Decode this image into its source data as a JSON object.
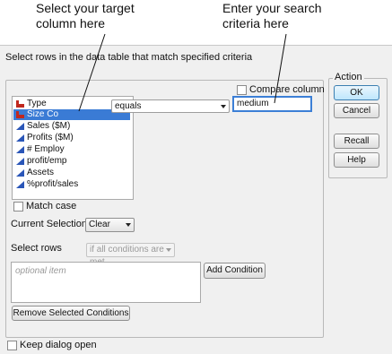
{
  "callouts": {
    "target_column": [
      "Select your target",
      "column here"
    ],
    "search_criteria": [
      "Enter your search",
      "criteria here"
    ]
  },
  "dialog": {
    "instruction": "Select rows in the data table that match specified criteria",
    "action_group": {
      "title": "Action",
      "ok": "OK",
      "cancel": "Cancel",
      "recall": "Recall",
      "help": "Help"
    },
    "columns": [
      {
        "label": "Type",
        "icon": "nominal-bar-icon",
        "icon_color": "#c0281e"
      },
      {
        "label": "Size Co",
        "icon": "nominal-bar-icon",
        "icon_color": "#c0281e",
        "selected": true
      },
      {
        "label": "Sales ($M)",
        "icon": "continuous-triangle-icon",
        "icon_color": "#2a56b8"
      },
      {
        "label": "Profits ($M)",
        "icon": "continuous-triangle-icon",
        "icon_color": "#2a56b8"
      },
      {
        "label": "# Employ",
        "icon": "continuous-triangle-icon",
        "icon_color": "#2a56b8"
      },
      {
        "label": "profit/emp",
        "icon": "continuous-triangle-icon",
        "icon_color": "#2a56b8"
      },
      {
        "label": "Assets",
        "icon": "continuous-triangle-icon",
        "icon_color": "#2a56b8"
      },
      {
        "label": "%profit/sales",
        "icon": "continuous-triangle-icon",
        "icon_color": "#2a56b8"
      }
    ],
    "operator": "equals",
    "compare_column": "Compare column",
    "search_value": "medium",
    "match_case": "Match case",
    "current_selection_label": "Current Selection",
    "current_selection_value": "Clear",
    "select_rows_label": "Select rows",
    "select_rows_value": "if all conditions are met",
    "conditions_placeholder": "optional item",
    "add_condition": "Add Condition",
    "remove_conditions": "Remove Selected Conditions",
    "keep_open": "Keep dialog open"
  }
}
